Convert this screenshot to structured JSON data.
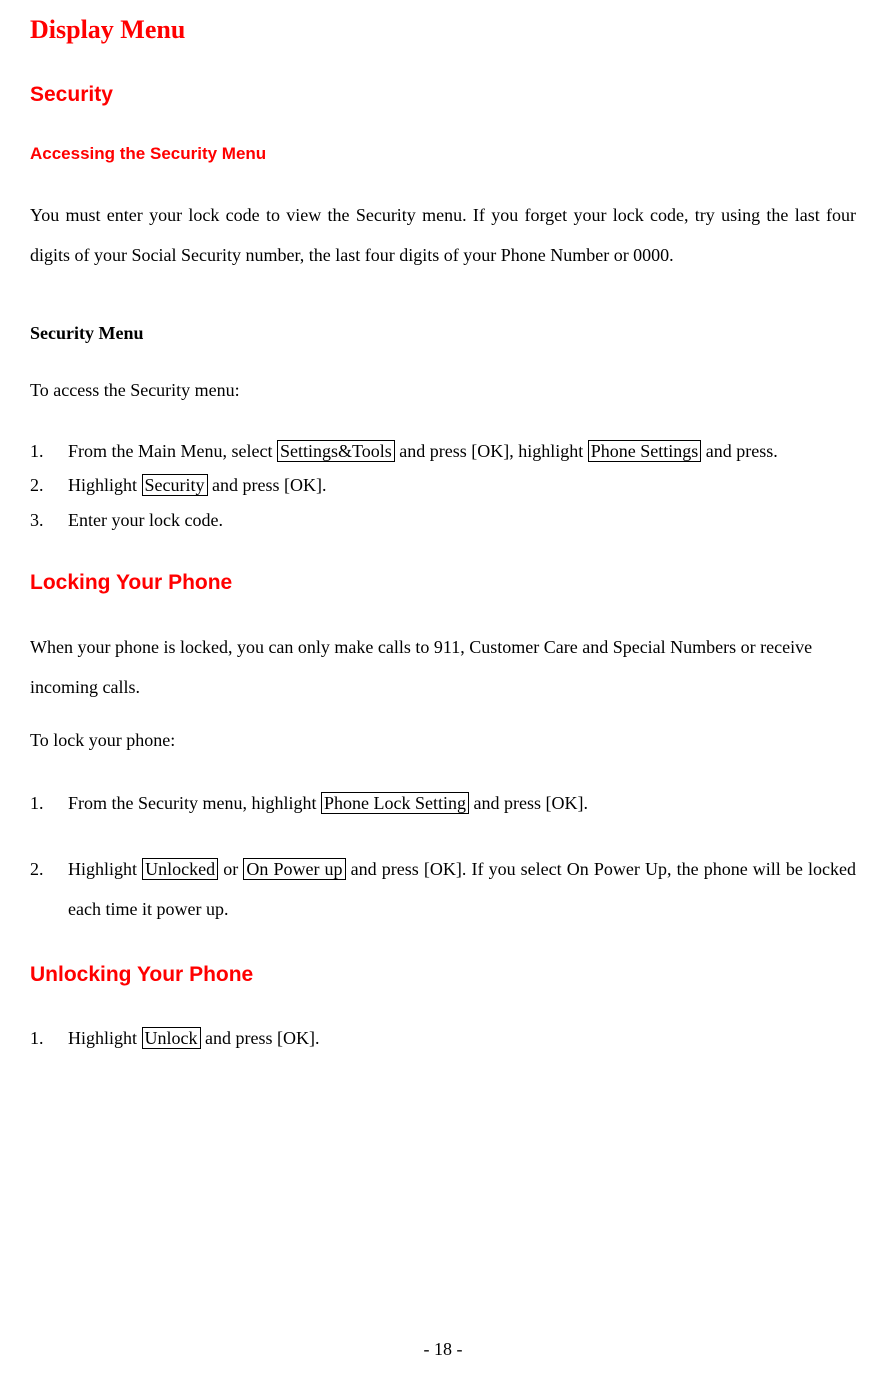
{
  "title": "Display Menu",
  "sections": {
    "security": {
      "heading": "Security",
      "accessing": {
        "heading": "Accessing the Security Menu",
        "paragraph": "You must enter your lock code to view the Security menu. If you forget your lock code, try using the last four digits of your Social Security number, the last four digits of your Phone Number or 0000."
      },
      "menu": {
        "heading": "Security Menu",
        "intro": "To access the Security menu:",
        "steps": {
          "step1": {
            "num": "1.",
            "pre": "From the Main Menu, select ",
            "box1": "Settings&Tools",
            "mid": " and press [OK], highlight ",
            "box2": "Phone Settings",
            "post": " and press."
          },
          "step2": {
            "num": "2.",
            "pre": "Highlight ",
            "box1": "Security",
            "post": " and press [OK]."
          },
          "step3": {
            "num": "3.",
            "text": "Enter your lock code."
          }
        }
      }
    },
    "locking": {
      "heading": "Locking Your Phone",
      "paragraph": "When your phone is locked, you can only make calls to 911, Customer Care and Special Numbers or receive incoming calls.",
      "intro": "To lock your phone:",
      "steps": {
        "step1": {
          "num": "1.",
          "pre": "From the Security menu, highlight ",
          "box1": "Phone Lock Setting",
          "post": " and press [OK]."
        },
        "step2": {
          "num": "2.",
          "pre": "Highlight ",
          "box1": "Unlocked",
          "mid": " or ",
          "box2": "On Power up",
          "post": " and press [OK]. If you select On Power Up, the phone will be locked each time it power up."
        }
      }
    },
    "unlocking": {
      "heading": "Unlocking Your Phone",
      "steps": {
        "step1": {
          "num": "1.",
          "pre": "Highlight ",
          "box1": "Unlock",
          "post": " and press [OK]."
        }
      }
    }
  },
  "pageNumber": "- 18 -"
}
